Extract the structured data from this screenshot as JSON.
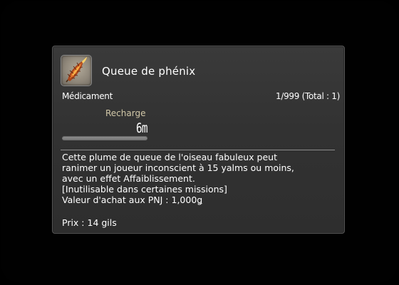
{
  "item": {
    "name": "Queue de phénix",
    "icon": "phoenix-down-feather-icon",
    "category": "Médicament",
    "quantity": "1/999 (Total : 1)"
  },
  "recast": {
    "label": "Recharge",
    "value": "6m",
    "progress": 0
  },
  "description": {
    "lines": [
      "Cette plume de queue de l'oiseau fabuleux peut",
      "ranimer un joueur inconscient à 15 yalms ou moins,",
      "avec un effet Affaiblissement.",
      "[Inutilisable dans certaines missions]",
      "Valeur d'achat aux PNJ : 1,000ǥ"
    ]
  },
  "price": {
    "text": "Prix : 14 gils"
  },
  "colors": {
    "background": "#000000",
    "panel": "#353535",
    "border": "#555555",
    "text": "#ffffff",
    "recast_label": "#d2c8a8",
    "divider": "#8c8c8c"
  }
}
